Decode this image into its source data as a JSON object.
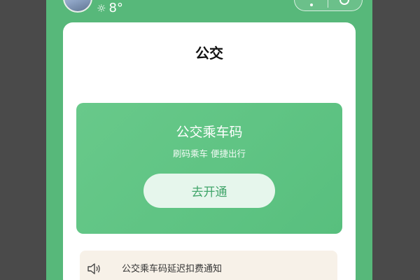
{
  "weather": {
    "icon": "sun-icon",
    "temperature": "8°"
  },
  "card": {
    "title": "公交"
  },
  "promo": {
    "title": "公交乘车码",
    "subtitle": "刷码乘车 便捷出行",
    "button_label": "去开通"
  },
  "notice": {
    "icon": "speaker-icon",
    "text": "公交乘车码延迟扣费通知"
  },
  "colors": {
    "page_background": "#57b87a",
    "promo_background": "#5fc585",
    "button_text": "#41a56a",
    "notice_background": "#f7f1e8"
  }
}
